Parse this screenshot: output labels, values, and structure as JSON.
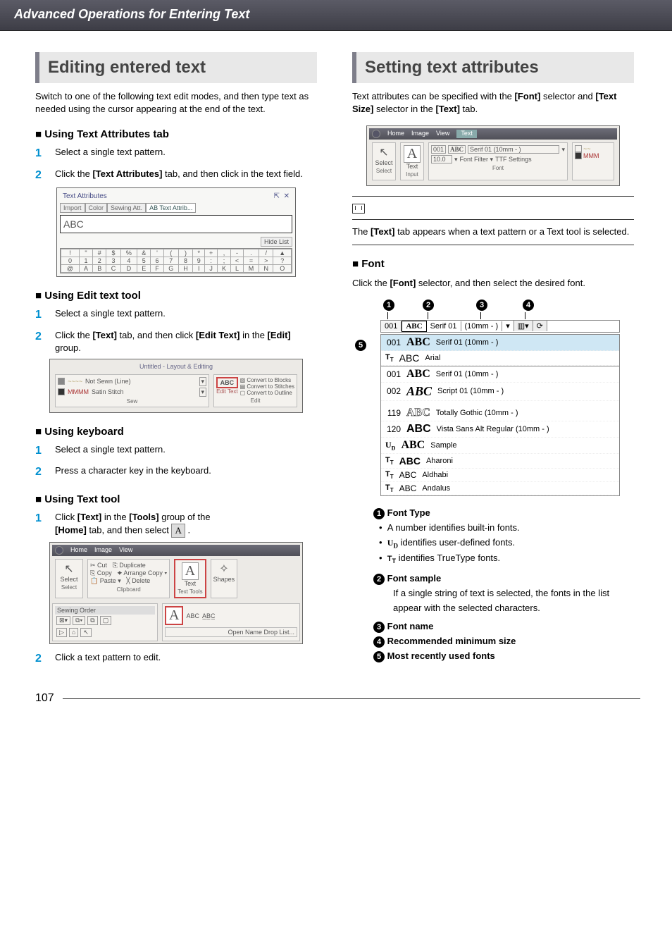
{
  "header": "Advanced Operations for Entering Text",
  "page_number": "107",
  "left": {
    "title": "Editing entered text",
    "intro": "Switch to one of the following text edit modes, and then type text as needed using the cursor appearing at the end of the text.",
    "sub1": "■ Using Text Attributes tab",
    "sub1_s1": "Select a single text pattern.",
    "sub1_s2_a": "Click the ",
    "sub1_s2_b": "[Text Attributes]",
    "sub1_s2_c": " tab, and then click in the text field.",
    "panel": {
      "title": "Text Attributes",
      "tabs": [
        "Import",
        "Color",
        "Sewing Att.",
        "AB Text Attrib..."
      ],
      "value": "ABC",
      "hide": "Hide List",
      "row1": [
        "!",
        "\"",
        "#",
        "$",
        "%",
        "&",
        "'",
        "(",
        ")",
        "*",
        "+",
        ",",
        "-",
        ".",
        "/",
        "▲"
      ],
      "row2": [
        "0",
        "1",
        "2",
        "3",
        "4",
        "5",
        "6",
        "7",
        "8",
        "9",
        ":",
        ";",
        "<",
        "=",
        ">",
        "?"
      ],
      "row3": [
        "@",
        "A",
        "B",
        "C",
        "D",
        "E",
        "F",
        "G",
        "H",
        "I",
        "J",
        "K",
        "L",
        "M",
        "N",
        "O"
      ]
    },
    "sub2": "■ Using Edit text tool",
    "sub2_s1": "Select a single text pattern.",
    "sub2_s2_a": "Click the ",
    "sub2_s2_b": "[Text]",
    "sub2_s2_c": " tab, and then click ",
    "sub2_s2_d": "[Edit Text]",
    "sub2_s2_e": " in the ",
    "sub2_s2_f": "[Edit]",
    "sub2_s2_g": " group.",
    "ribbon2": {
      "title": "Untitled - Layout & Editing",
      "sew_label": "Sew",
      "edit_label": "Edit",
      "line1": "Not Sewn (Line)",
      "line2": "Satin Stitch",
      "abc": "ABC",
      "edit_text": "Edit Text",
      "c1": "Convert to Blocks",
      "c2": "Convert to Stitches",
      "c3": "Convert to Outline"
    },
    "sub3": "■ Using keyboard",
    "sub3_s1": "Select a single text pattern.",
    "sub3_s2": "Press a character key in the keyboard.",
    "sub4": "■ Using Text tool",
    "sub4_s1_a": "Click ",
    "sub4_s1_b": "[Text]",
    "sub4_s1_c": " in the ",
    "sub4_s1_d": "[Tools]",
    "sub4_s1_e": " group of the ",
    "sub4_s1_f": "[Home]",
    "sub4_s1_g": " tab, and then select ",
    "sub4_s1_icon": "A",
    "sub4_s1_h": " .",
    "ribbon4": {
      "tabs": [
        "Home",
        "Image",
        "View"
      ],
      "select": "Select",
      "select2": "Select",
      "cut": "Cut",
      "copy": "Copy",
      "paste": "Paste ▾",
      "dup": "Duplicate",
      "arrange": "Arrange Copy ▾",
      "del": "Delete",
      "clipboard": "Clipboard",
      "text": "Text",
      "tools": "Text Tools",
      "shapes": "Shapes",
      "sewing_order": "Sewing Order",
      "open_list": "Open Name Drop List...",
      "abc": "ABC"
    },
    "sub4_s2": "Click a text pattern to edit."
  },
  "right": {
    "title": "Setting text attributes",
    "intro_a": "Text attributes can be specified with the ",
    "intro_b": "[Font]",
    "intro_c": " selector and ",
    "intro_d": "[Text Size]",
    "intro_e": " selector in the ",
    "intro_f": "[Text]",
    "intro_g": " tab.",
    "ribbon": {
      "tabs": [
        "Home",
        "Image",
        "View",
        "Text"
      ],
      "select": "Select",
      "select2": "Select",
      "text": "Text",
      "input": "Input",
      "a": "A",
      "num": "001",
      "abc": "ABC",
      "font_desc": "Serif 01  (10mm - )",
      "size": "10.0",
      "ff": "Font Filter ▾",
      "ttf": "TTF Settings",
      "font": "Font"
    },
    "note": "The [Text] tab appears when a text pattern or a Text tool is selected.",
    "font_head": "■ Font",
    "font_intro_a": "Click the ",
    "font_intro_b": "[Font]",
    "font_intro_c": " selector, and then select the desired font.",
    "markers": [
      "1",
      "2",
      "3",
      "4",
      "5"
    ],
    "selector": {
      "num": "001",
      "abc": "ABC",
      "name": "Serif 01",
      "size": "(10mm - )"
    },
    "list": [
      {
        "num": "001",
        "prefix": "",
        "sample": "ABC",
        "name": "Serif 01  (10mm - )",
        "hi": true,
        "style": "serif-bold"
      },
      {
        "num": "",
        "prefix": "Tr",
        "sample": "ABC",
        "name": "Arial",
        "style": "sans"
      },
      {
        "num": "001",
        "prefix": "",
        "sample": "ABC",
        "name": "Serif 01  (10mm - )",
        "style": "serif-bold"
      },
      {
        "num": "002",
        "prefix": "",
        "sample": "ABC",
        "name": "Script 01  (10mm - )",
        "style": "script"
      },
      {
        "num": "119",
        "prefix": "",
        "sample": "ABC",
        "name": "Totally Gothic  (10mm - )",
        "style": "outline"
      },
      {
        "num": "120",
        "prefix": "",
        "sample": "ABC",
        "name": "Vista Sans Alt Regular  (10mm - )",
        "style": "vista"
      },
      {
        "num": "",
        "prefix": "Ud",
        "sample": "ABC",
        "name": "Sample",
        "style": "serif-bold"
      },
      {
        "num": "",
        "prefix": "Tr",
        "sample": "ABC",
        "name": "Aharoni",
        "style": "bold"
      },
      {
        "num": "",
        "prefix": "Tr",
        "sample": "ABC",
        "name": "Aldhabi",
        "style": "thin"
      },
      {
        "num": "",
        "prefix": "Tr",
        "sample": "ABC",
        "name": "Andalus",
        "style": "thin"
      }
    ],
    "legend": {
      "l1": "Font Type",
      "l1a": "A number identifies built-in fonts.",
      "l1b_pre": "",
      "l1b_icon": "Uᴅ",
      "l1b": " identifies user-defined fonts.",
      "l1c_icon": "Tᴛ",
      "l1c": " identifies TrueType fonts.",
      "l2": "Font sample",
      "l2a": "If a single string of text is selected, the fonts in the list appear with the selected characters.",
      "l3": "Font name",
      "l4": "Recommended minimum size",
      "l5": "Most recently used fonts"
    }
  }
}
